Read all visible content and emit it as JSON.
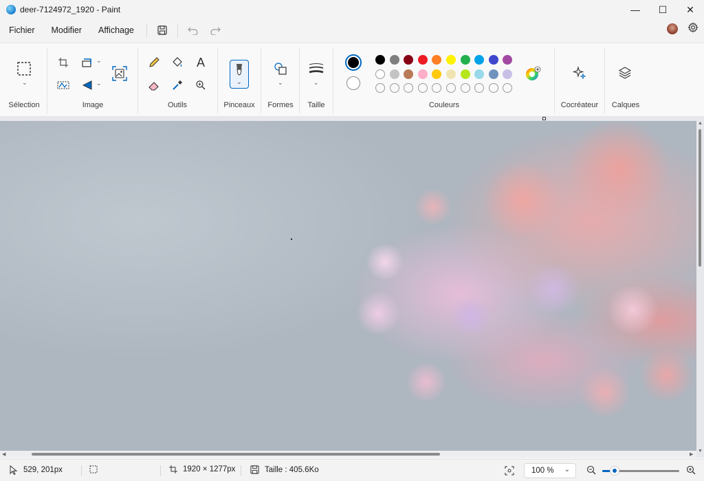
{
  "window": {
    "title": "deer-7124972_1920 - Paint",
    "minimize_glyph": "—",
    "maximize_glyph": "☐",
    "close_glyph": "✕"
  },
  "menu": {
    "file": "Fichier",
    "edit": "Modifier",
    "view": "Affichage"
  },
  "ribbon": {
    "groups": {
      "selection": "Sélection",
      "image": "Image",
      "tools": "Outils",
      "brushes": "Pinceaux",
      "shapes": "Formes",
      "size": "Taille",
      "colors": "Couleurs",
      "creator": "Cocréateur",
      "layers": "Calques"
    },
    "text_tool_glyph": "A"
  },
  "colors": {
    "primary": "#000000",
    "secondary": "#ffffff",
    "row1": [
      "#000000",
      "#7f7f7f",
      "#880015",
      "#ed1c24",
      "#ff7f27",
      "#fff200",
      "#22b14c",
      "#00a2e8",
      "#3f48cc",
      "#a349a4"
    ],
    "row2": [
      "#ffffff",
      "#c3c3c3",
      "#b97a57",
      "#ffaec9",
      "#ffc90e",
      "#efe4b0",
      "#b5e61d",
      "#99d9ea",
      "#7092be",
      "#c8bfe7"
    ],
    "row3_empty_count": 10,
    "accent": "#0067c0"
  },
  "status": {
    "cursor_pos": "529, 201px",
    "dimensions": "1920 × 1277px",
    "file_size": "Taille : 405.6Ko",
    "zoom": "100 %",
    "zoom_fraction": 0.16
  }
}
